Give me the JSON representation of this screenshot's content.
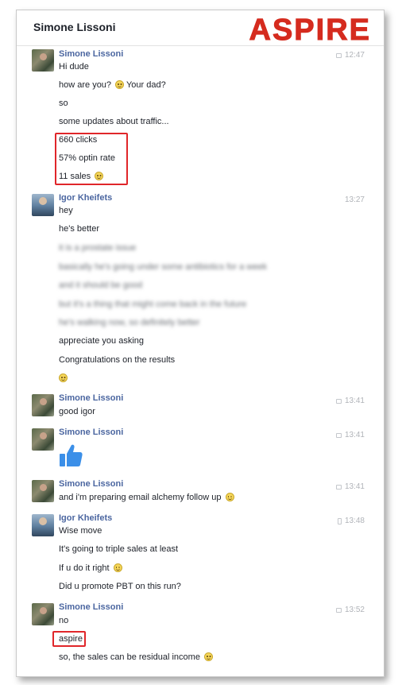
{
  "header": {
    "title": "Simone Lissoni",
    "logo_text": "ASPIRE"
  },
  "messages": [
    {
      "sender": "Simone Lissoni",
      "time": "12:47",
      "lines": [
        "Hi dude",
        "how are you?",
        "Your dad?",
        "so",
        "some updates about traffic...",
        "660 clicks",
        "57% optin rate",
        "11 sales"
      ]
    },
    {
      "sender": "Igor Kheifets",
      "time": "13:27",
      "lines": [
        "hey",
        "he's better",
        "it is a prostate issue",
        "basically he's going under some antibiotics for a week",
        "and it should be good",
        "but it's a thing that might come back in the future",
        "he's walking now, so definitely better",
        "appreciate you asking",
        "Congratulations on the results"
      ]
    },
    {
      "sender": "Simone Lissoni",
      "time": "13:41",
      "lines": [
        "good igor"
      ]
    },
    {
      "sender": "Simone Lissoni",
      "time": "13:41",
      "lines": []
    },
    {
      "sender": "Simone Lissoni",
      "time": "13:41",
      "lines": [
        "and i'm preparing email alchemy follow up"
      ]
    },
    {
      "sender": "Igor Kheifets",
      "time": "13:48",
      "lines": [
        "Wise move",
        "It's going to triple sales at least",
        "If u do it right",
        "Did u promote PBT on this run?"
      ]
    },
    {
      "sender": "Simone Lissoni",
      "time": "13:52",
      "lines": [
        "no",
        "aspire",
        "so, the sales can be residual income"
      ]
    }
  ],
  "colors": {
    "accent": "#4b66a0",
    "highlight_box": "#e0262a",
    "logo": "#d52b1e",
    "thumb": "#3b8fe8"
  }
}
